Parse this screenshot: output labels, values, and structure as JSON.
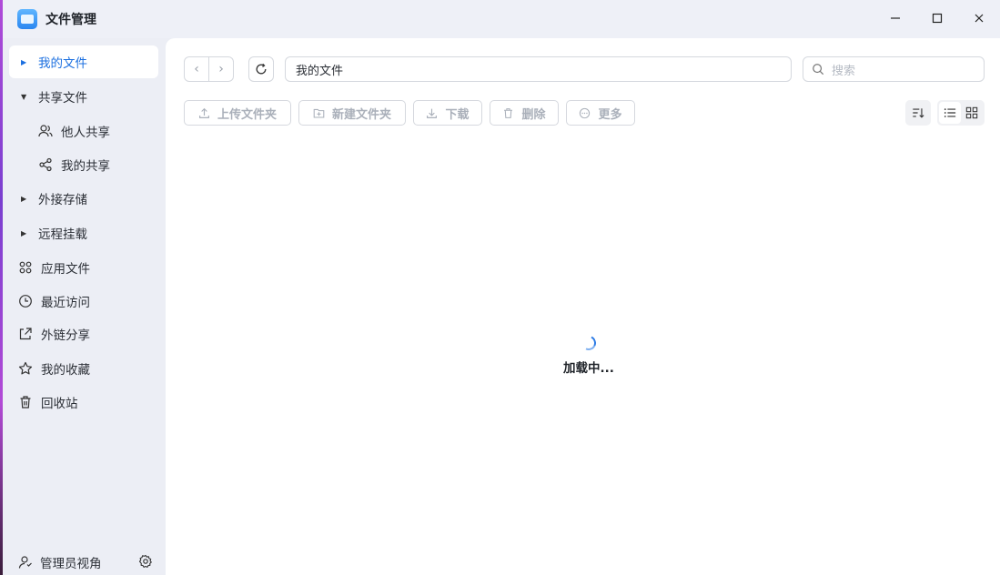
{
  "window": {
    "title": "文件管理",
    "controls": {
      "minimize": "—",
      "maximize": "☐",
      "close": "✕"
    }
  },
  "sidebar": {
    "items": [
      {
        "label": "我的文件",
        "icon": "caret-right-icon",
        "active": true
      },
      {
        "label": "共享文件",
        "icon": "caret-down-icon"
      },
      {
        "label": "他人共享",
        "icon": "people-icon"
      },
      {
        "label": "我的共享",
        "icon": "share-icon"
      },
      {
        "label": "外接存储",
        "icon": "caret-right-icon"
      },
      {
        "label": "远程挂载",
        "icon": "caret-right-icon"
      },
      {
        "label": "应用文件",
        "icon": "apps-grid-icon"
      },
      {
        "label": "最近访问",
        "icon": "clock-icon"
      },
      {
        "label": "外链分享",
        "icon": "external-link-icon"
      },
      {
        "label": "我的收藏",
        "icon": "star-icon"
      },
      {
        "label": "回收站",
        "icon": "trash-icon"
      }
    ],
    "admin": {
      "label": "管理员视角"
    }
  },
  "toolbar": {
    "path": "我的文件",
    "search_placeholder": "搜索",
    "upload_label": "上传文件夹",
    "new_folder_label": "新建文件夹",
    "download_label": "下载",
    "delete_label": "删除",
    "more_label": "更多"
  },
  "content": {
    "loading_text": "加载中..."
  },
  "colors": {
    "accent": "#1b6fe0",
    "sidebar_bg": "#eceef5",
    "disabled_text": "#aab0ba"
  }
}
